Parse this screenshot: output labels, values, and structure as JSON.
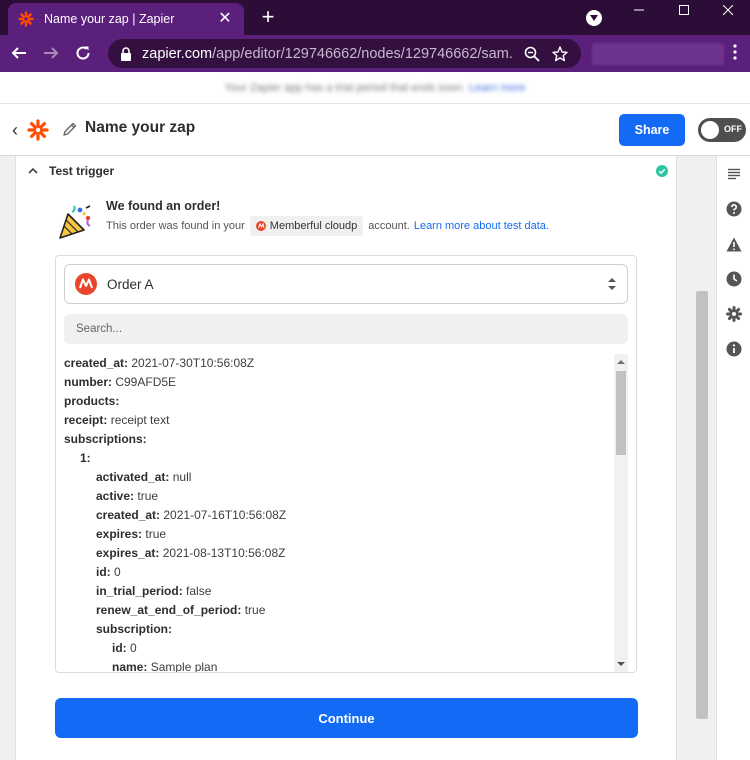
{
  "browser": {
    "tab_title": "Name your zap | Zapier",
    "tab_close": "✕",
    "new_tab": "+",
    "url_host": "zapier.com",
    "url_path": "/app/editor/129746662/nodes/129746662/sam...",
    "infobar_text": "Your Zapier app has a trial period that ends soon.",
    "infobar_link": "Learn more"
  },
  "header": {
    "back_glyph": "‹",
    "zap_name": "Name your zap",
    "share_label": "Share",
    "toggle_label": "OFF"
  },
  "section": {
    "title": "Test trigger"
  },
  "result": {
    "title": "We found an order!",
    "found_prefix": "This order was found in your",
    "app_name": "Memberful cloudp",
    "found_suffix": "account.",
    "learn_link": "Learn more about test data."
  },
  "record_select": {
    "value": "Order A"
  },
  "search": {
    "placeholder": "Search..."
  },
  "records": [
    {
      "level": 0,
      "key": "created_at:",
      "value": "2021-07-30T10:56:08Z"
    },
    {
      "level": 0,
      "key": "number:",
      "value": "C99AFD5E"
    },
    {
      "level": 0,
      "key": "products:",
      "value": ""
    },
    {
      "level": 0,
      "key": "receipt:",
      "value": "receipt text"
    },
    {
      "level": 0,
      "key": "subscriptions:",
      "value": ""
    },
    {
      "level": 1,
      "key": "1:",
      "value": ""
    },
    {
      "level": 2,
      "key": "activated_at:",
      "value": "null"
    },
    {
      "level": 2,
      "key": "active:",
      "value": "true"
    },
    {
      "level": 2,
      "key": "created_at:",
      "value": "2021-07-16T10:56:08Z"
    },
    {
      "level": 2,
      "key": "expires:",
      "value": "true"
    },
    {
      "level": 2,
      "key": "expires_at:",
      "value": "2021-08-13T10:56:08Z"
    },
    {
      "level": 2,
      "key": "id:",
      "value": "0"
    },
    {
      "level": 2,
      "key": "in_trial_period:",
      "value": "false"
    },
    {
      "level": 2,
      "key": "renew_at_end_of_period:",
      "value": "true"
    },
    {
      "level": 2,
      "key": "subscription:",
      "value": ""
    },
    {
      "level": 3,
      "key": "id:",
      "value": "0"
    },
    {
      "level": 3,
      "key": "name:",
      "value": "Sample plan"
    }
  ],
  "continue_label": "Continue",
  "colors": {
    "tab_bg": "#2b0d38",
    "toolbar_bg": "#5b1f7c",
    "zapier_orange": "#ff4a00",
    "primary_blue": "#136bf5",
    "success_green": "#2fc6a5",
    "memberful_red": "#e8452c"
  },
  "icons": {
    "rail": [
      "notes-icon",
      "help-icon",
      "warning-icon",
      "history-icon",
      "settings-icon",
      "info-icon"
    ]
  }
}
